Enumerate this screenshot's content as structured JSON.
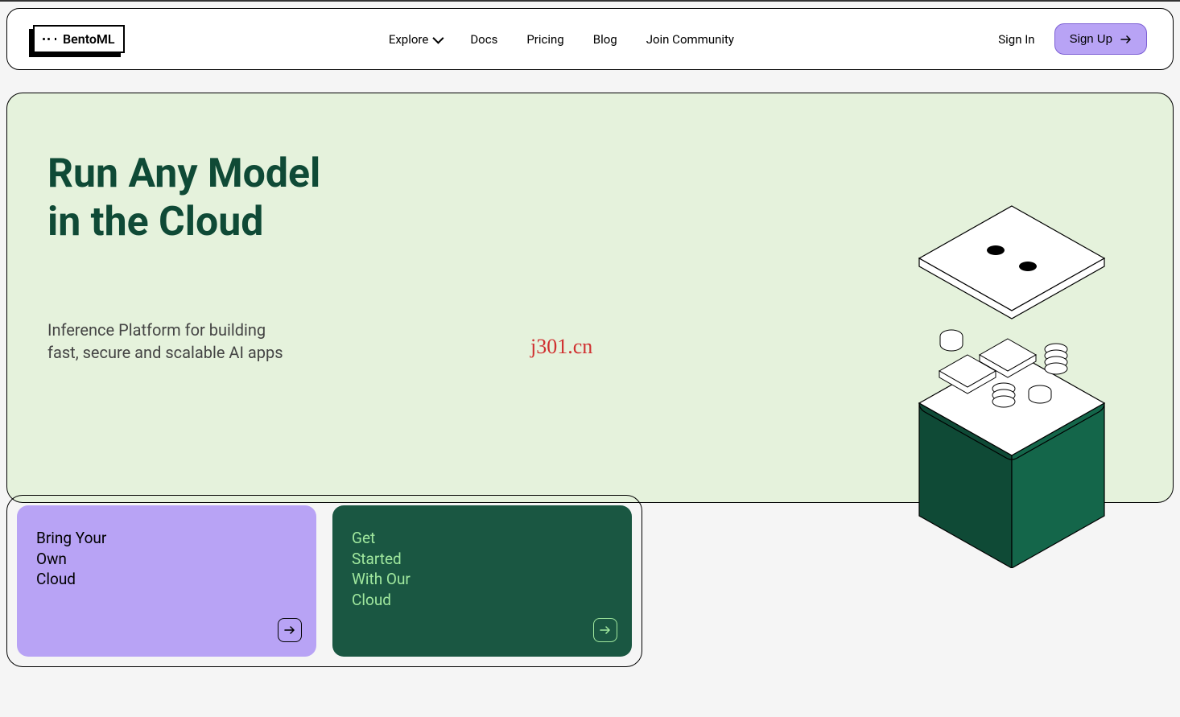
{
  "logo": {
    "text": "BentoML"
  },
  "nav": {
    "explore": "Explore",
    "docs": "Docs",
    "pricing": "Pricing",
    "blog": "Blog",
    "community": "Join Community"
  },
  "header": {
    "signin": "Sign In",
    "signup": "Sign Up"
  },
  "hero": {
    "title_line1": "Run Any Model",
    "title_line2": "in the Cloud",
    "subtitle_line1": "Inference Platform for building",
    "subtitle_line2": "fast, secure and scalable AI apps"
  },
  "watermark": "j301.cn",
  "cards": {
    "byoc": {
      "line1": "Bring Your",
      "line2": "Own",
      "line3": "Cloud"
    },
    "getstarted": {
      "line1": "Get",
      "line2": "Started",
      "line3": "With Our",
      "line4": "Cloud"
    }
  }
}
